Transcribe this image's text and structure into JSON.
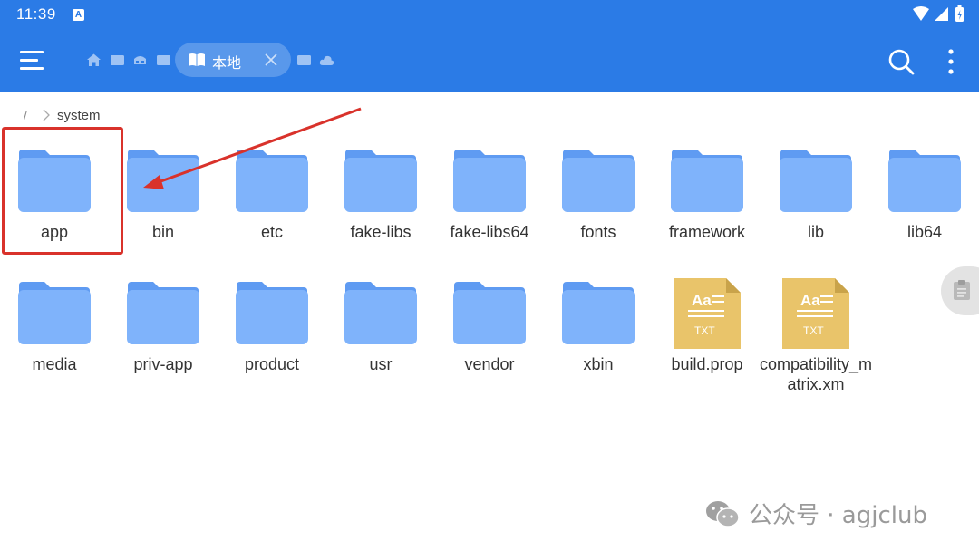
{
  "status_bar": {
    "time": "11:39",
    "badge": "A"
  },
  "toolbar": {
    "menu_icon": "menu-icon",
    "breadcrumb_icons": [
      "home-icon",
      "window-icon",
      "network-icon",
      "window-icon"
    ],
    "active_tab": {
      "label": "本地",
      "icon": "book-icon",
      "close_icon": "close-icon"
    },
    "trailing_icons": [
      "window-icon",
      "cloud-icon"
    ],
    "search_icon": "search-icon",
    "more_icon": "more-vertical-icon"
  },
  "path": {
    "root": "/",
    "current": "system"
  },
  "items": [
    {
      "name": "app",
      "type": "folder"
    },
    {
      "name": "bin",
      "type": "folder"
    },
    {
      "name": "etc",
      "type": "folder"
    },
    {
      "name": "fake-libs",
      "type": "folder"
    },
    {
      "name": "fake-libs64",
      "type": "folder"
    },
    {
      "name": "fonts",
      "type": "folder"
    },
    {
      "name": "framework",
      "type": "folder"
    },
    {
      "name": "lib",
      "type": "folder"
    },
    {
      "name": "lib64",
      "type": "folder"
    },
    {
      "name": "media",
      "type": "folder"
    },
    {
      "name": "priv-app",
      "type": "folder"
    },
    {
      "name": "product",
      "type": "folder"
    },
    {
      "name": "usr",
      "type": "folder"
    },
    {
      "name": "vendor",
      "type": "folder"
    },
    {
      "name": "xbin",
      "type": "folder"
    },
    {
      "name": "build.prop",
      "type": "txt"
    },
    {
      "name": "compatibility_matrix.xm",
      "type": "txt"
    }
  ],
  "txt_icon": {
    "top_text": "Aa",
    "bottom_text": "TXT"
  },
  "colors": {
    "appbar": "#2b7be6",
    "folder_body": "#7fb3fb",
    "folder_tab": "#5f9bf2",
    "txt_icon": "#e9c46a",
    "highlight": "#d9322b"
  },
  "watermark": {
    "text": "公众号 · agjclub"
  }
}
